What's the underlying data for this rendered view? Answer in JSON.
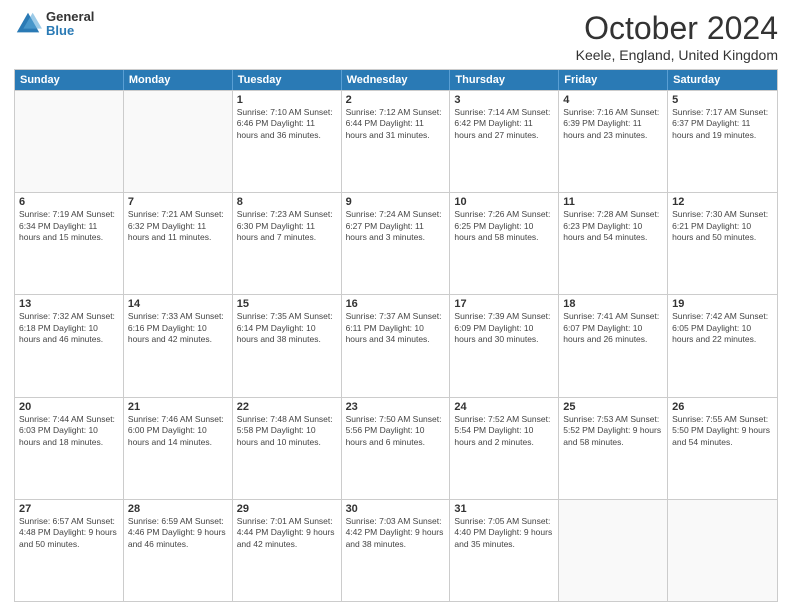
{
  "logo": {
    "general": "General",
    "blue": "Blue"
  },
  "title": "October 2024",
  "location": "Keele, England, United Kingdom",
  "days": [
    "Sunday",
    "Monday",
    "Tuesday",
    "Wednesday",
    "Thursday",
    "Friday",
    "Saturday"
  ],
  "rows": [
    [
      {
        "day": "",
        "info": ""
      },
      {
        "day": "",
        "info": ""
      },
      {
        "day": "1",
        "info": "Sunrise: 7:10 AM\nSunset: 6:46 PM\nDaylight: 11 hours and 36 minutes."
      },
      {
        "day": "2",
        "info": "Sunrise: 7:12 AM\nSunset: 6:44 PM\nDaylight: 11 hours and 31 minutes."
      },
      {
        "day": "3",
        "info": "Sunrise: 7:14 AM\nSunset: 6:42 PM\nDaylight: 11 hours and 27 minutes."
      },
      {
        "day": "4",
        "info": "Sunrise: 7:16 AM\nSunset: 6:39 PM\nDaylight: 11 hours and 23 minutes."
      },
      {
        "day": "5",
        "info": "Sunrise: 7:17 AM\nSunset: 6:37 PM\nDaylight: 11 hours and 19 minutes."
      }
    ],
    [
      {
        "day": "6",
        "info": "Sunrise: 7:19 AM\nSunset: 6:34 PM\nDaylight: 11 hours and 15 minutes."
      },
      {
        "day": "7",
        "info": "Sunrise: 7:21 AM\nSunset: 6:32 PM\nDaylight: 11 hours and 11 minutes."
      },
      {
        "day": "8",
        "info": "Sunrise: 7:23 AM\nSunset: 6:30 PM\nDaylight: 11 hours and 7 minutes."
      },
      {
        "day": "9",
        "info": "Sunrise: 7:24 AM\nSunset: 6:27 PM\nDaylight: 11 hours and 3 minutes."
      },
      {
        "day": "10",
        "info": "Sunrise: 7:26 AM\nSunset: 6:25 PM\nDaylight: 10 hours and 58 minutes."
      },
      {
        "day": "11",
        "info": "Sunrise: 7:28 AM\nSunset: 6:23 PM\nDaylight: 10 hours and 54 minutes."
      },
      {
        "day": "12",
        "info": "Sunrise: 7:30 AM\nSunset: 6:21 PM\nDaylight: 10 hours and 50 minutes."
      }
    ],
    [
      {
        "day": "13",
        "info": "Sunrise: 7:32 AM\nSunset: 6:18 PM\nDaylight: 10 hours and 46 minutes."
      },
      {
        "day": "14",
        "info": "Sunrise: 7:33 AM\nSunset: 6:16 PM\nDaylight: 10 hours and 42 minutes."
      },
      {
        "day": "15",
        "info": "Sunrise: 7:35 AM\nSunset: 6:14 PM\nDaylight: 10 hours and 38 minutes."
      },
      {
        "day": "16",
        "info": "Sunrise: 7:37 AM\nSunset: 6:11 PM\nDaylight: 10 hours and 34 minutes."
      },
      {
        "day": "17",
        "info": "Sunrise: 7:39 AM\nSunset: 6:09 PM\nDaylight: 10 hours and 30 minutes."
      },
      {
        "day": "18",
        "info": "Sunrise: 7:41 AM\nSunset: 6:07 PM\nDaylight: 10 hours and 26 minutes."
      },
      {
        "day": "19",
        "info": "Sunrise: 7:42 AM\nSunset: 6:05 PM\nDaylight: 10 hours and 22 minutes."
      }
    ],
    [
      {
        "day": "20",
        "info": "Sunrise: 7:44 AM\nSunset: 6:03 PM\nDaylight: 10 hours and 18 minutes."
      },
      {
        "day": "21",
        "info": "Sunrise: 7:46 AM\nSunset: 6:00 PM\nDaylight: 10 hours and 14 minutes."
      },
      {
        "day": "22",
        "info": "Sunrise: 7:48 AM\nSunset: 5:58 PM\nDaylight: 10 hours and 10 minutes."
      },
      {
        "day": "23",
        "info": "Sunrise: 7:50 AM\nSunset: 5:56 PM\nDaylight: 10 hours and 6 minutes."
      },
      {
        "day": "24",
        "info": "Sunrise: 7:52 AM\nSunset: 5:54 PM\nDaylight: 10 hours and 2 minutes."
      },
      {
        "day": "25",
        "info": "Sunrise: 7:53 AM\nSunset: 5:52 PM\nDaylight: 9 hours and 58 minutes."
      },
      {
        "day": "26",
        "info": "Sunrise: 7:55 AM\nSunset: 5:50 PM\nDaylight: 9 hours and 54 minutes."
      }
    ],
    [
      {
        "day": "27",
        "info": "Sunrise: 6:57 AM\nSunset: 4:48 PM\nDaylight: 9 hours and 50 minutes."
      },
      {
        "day": "28",
        "info": "Sunrise: 6:59 AM\nSunset: 4:46 PM\nDaylight: 9 hours and 46 minutes."
      },
      {
        "day": "29",
        "info": "Sunrise: 7:01 AM\nSunset: 4:44 PM\nDaylight: 9 hours and 42 minutes."
      },
      {
        "day": "30",
        "info": "Sunrise: 7:03 AM\nSunset: 4:42 PM\nDaylight: 9 hours and 38 minutes."
      },
      {
        "day": "31",
        "info": "Sunrise: 7:05 AM\nSunset: 4:40 PM\nDaylight: 9 hours and 35 minutes."
      },
      {
        "day": "",
        "info": ""
      },
      {
        "day": "",
        "info": ""
      }
    ]
  ]
}
